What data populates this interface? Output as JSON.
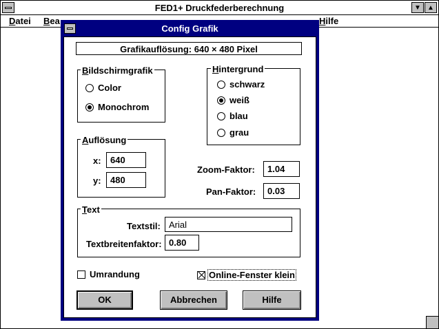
{
  "main_window": {
    "title": "FED1+   Druckfederberechnung",
    "menu": [
      "Datei",
      "Bea",
      "Hilfe"
    ]
  },
  "dialog": {
    "title": "Config Grafik",
    "resolution_info": "Grafikauflösung: 640 × 480 Pixel",
    "bildschirmgrafik": {
      "label": "Bildschirmgrafik",
      "options": [
        "Color",
        "Monochrom"
      ],
      "selected": "Monochrom"
    },
    "hintergrund": {
      "label": "Hintergrund",
      "options": [
        "schwarz",
        "weiß",
        "blau",
        "grau"
      ],
      "selected": "weiß"
    },
    "aufloesung": {
      "label": "Auflösung",
      "x_label": "x:",
      "x_value": "640",
      "y_label": "y:",
      "y_value": "480"
    },
    "zoom_label": "Zoom-Faktor:",
    "zoom_value": "1.04",
    "pan_label": "Pan-Faktor:",
    "pan_value": "0.03",
    "text_group": {
      "label": "Text",
      "style_label": "Textstil:",
      "style_value": "Arial",
      "width_label": "Textbreitenfaktor:",
      "width_value": "0.80"
    },
    "umrandung": {
      "label": "Umrandung",
      "checked": false
    },
    "online_small": {
      "label": "Online-Fenster klein",
      "checked": true
    },
    "buttons": {
      "ok": "OK",
      "cancel": "Abbrechen",
      "help": "Hilfe"
    }
  }
}
